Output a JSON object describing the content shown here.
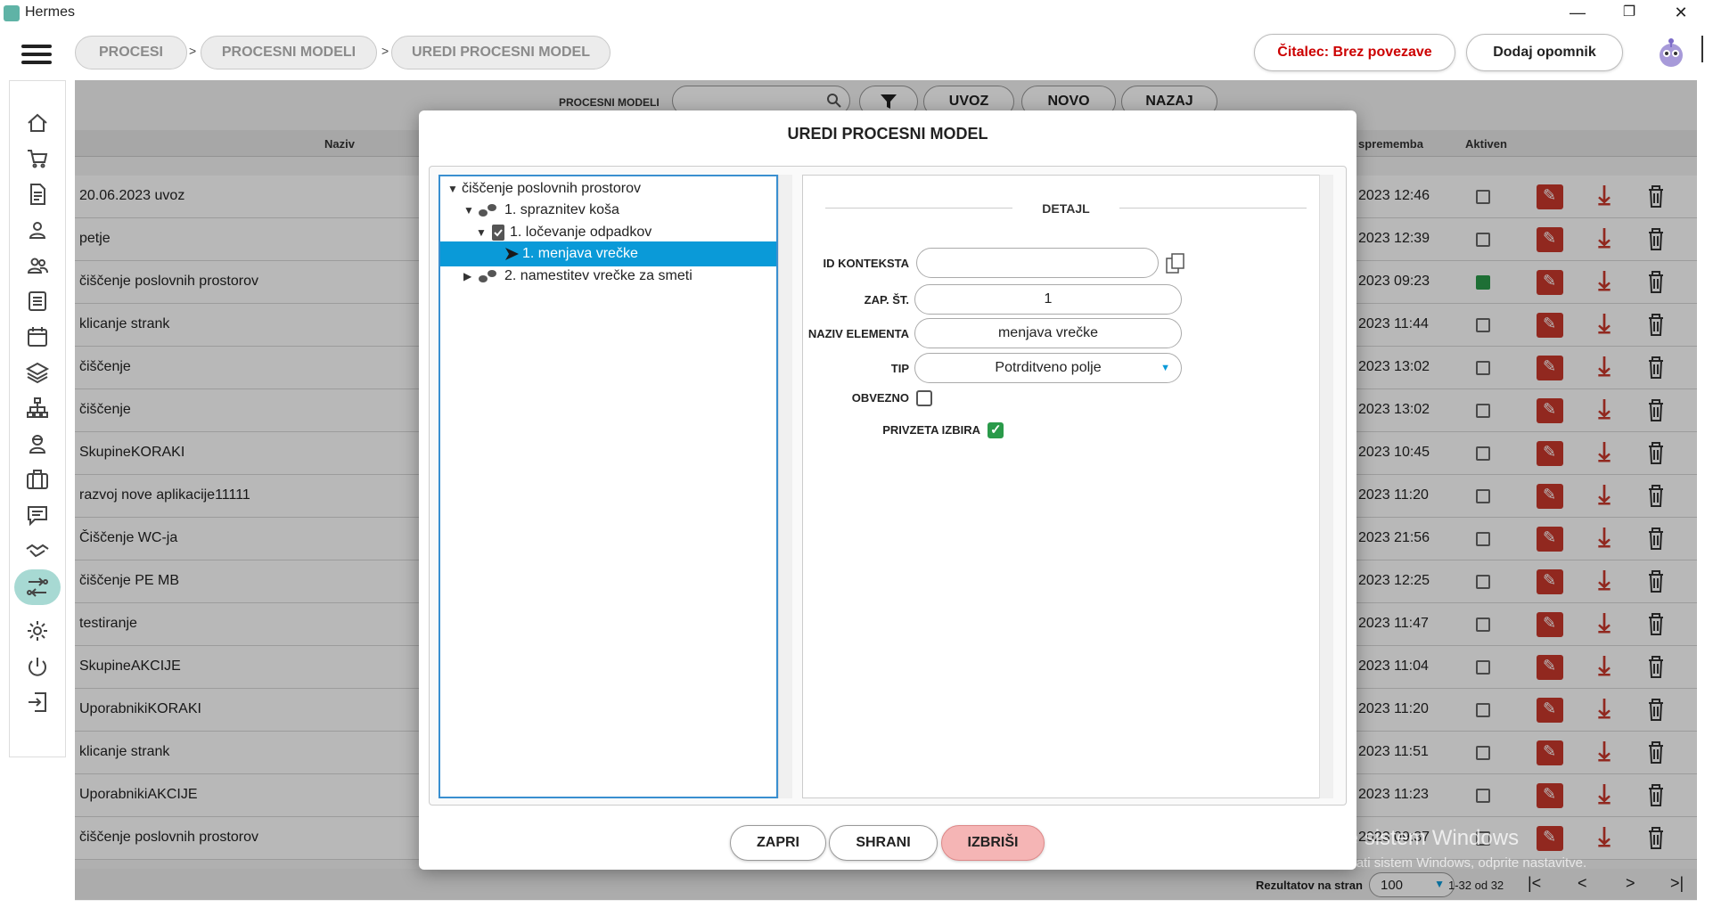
{
  "window": {
    "title": "Hermes",
    "min": "—",
    "restore": "❐",
    "close": "✕"
  },
  "breadcrumb": [
    {
      "label": "PROCESI"
    },
    {
      "label": "PROCESNI MODELI"
    },
    {
      "label": "UREDI PROCESNI MODEL"
    }
  ],
  "breadcrumb_sep": ">",
  "header": {
    "reader_status": "Čitalec: Brez povezave",
    "reader_color": "#cc0000",
    "add_reminder": "Dodaj opomnik"
  },
  "sidebar": [
    "home-icon",
    "cart-icon",
    "document-icon",
    "user-icon",
    "users-icon",
    "list-icon",
    "calendar-icon",
    "layers-icon",
    "hierarchy-icon",
    "worker-icon",
    "briefcase-icon",
    "chat-icon",
    "handshake-icon",
    "process-icon",
    "gear-icon",
    "power-icon",
    "logout-icon"
  ],
  "toolbar": {
    "label": "PROCESNI MODELI",
    "search_value": "",
    "buttons": [
      "UVOZ",
      "NOVO",
      "NAZAJ"
    ]
  },
  "list": {
    "columns": {
      "name": "Naziv",
      "changed": "sprememba",
      "active": "Aktiven"
    },
    "rows": [
      {
        "name": "20.06.2023 uvoz",
        "date": "2023 12:46",
        "active": false
      },
      {
        "name": "petje",
        "date": "2023 12:39",
        "active": false
      },
      {
        "name": "čiščenje poslovnih prostorov",
        "date": "2023 09:23",
        "active": true
      },
      {
        "name": "klicanje strank",
        "date": "2023 11:44",
        "active": false
      },
      {
        "name": "čiščenje",
        "date": "2023 13:02",
        "active": false
      },
      {
        "name": "čiščenje",
        "date": "2023 13:02",
        "active": false
      },
      {
        "name": "SkupineKORAKI",
        "date": "2023 10:45",
        "active": false
      },
      {
        "name": "razvoj nove aplikacije11111",
        "date": "2023 11:20",
        "active": false
      },
      {
        "name": "Čiščenje WC-ja",
        "date": "2023 21:56",
        "active": false
      },
      {
        "name": "čiščenje PE MB",
        "date": "2023 12:25",
        "active": false
      },
      {
        "name": "testiranje",
        "date": "2023 11:47",
        "active": false
      },
      {
        "name": "SkupineAKCIJE",
        "date": "2023 11:04",
        "active": false
      },
      {
        "name": "UporabnikiKORAKI",
        "date": "2023 11:20",
        "active": false
      },
      {
        "name": "klicanje strank",
        "date": "2023 11:51",
        "active": false
      },
      {
        "name": "UporabnikiAKCIJE",
        "date": "2023 11:23",
        "active": false
      },
      {
        "name": "čiščenje poslovnih prostorov",
        "date": "2023 09:37",
        "active": false
      }
    ]
  },
  "footer": {
    "per_page_label": "Rezultatov na stran",
    "per_page": "100",
    "range": "1-32 od 32"
  },
  "watermark": {
    "line1": "Aktivirajte sistem Windows",
    "line2": "Če želite aktivirati sistem Windows, odprite nastavitve."
  },
  "modal": {
    "title": "UREDI PROCESNI MODEL",
    "tree": [
      {
        "label": "čiščenje poslovnih prostorov",
        "expanded": true,
        "icon": ""
      },
      {
        "label": "1. spraznitev koša",
        "expanded": true,
        "icon": "steps-icon"
      },
      {
        "label": "1. ločevanje odpadkov",
        "expanded": true,
        "icon": "checklist-icon"
      },
      {
        "label": "1. menjava vrečke",
        "selected": true,
        "icon": "action-arrow-icon"
      },
      {
        "label": "2. namestitev vrečke za smeti",
        "expanded": false,
        "icon": "steps-icon"
      }
    ],
    "detail": {
      "header": "DETAJL",
      "id_context_label": "ID KONTEKSTA",
      "id_context_value": "",
      "order_label": "ZAP. ŠT.",
      "order_value": "1",
      "name_label": "NAZIV ELEMENTA",
      "name_value": "menjava vrečke",
      "type_label": "TIP",
      "type_value": "Potrditveno polje",
      "required_label": "OBVEZNO",
      "required": false,
      "default_label": "PRIVZETA IZBIRA",
      "default_checked": true
    },
    "buttons": {
      "close": "ZAPRI",
      "save": "SHRANI",
      "delete": "IZBRIŠI"
    }
  }
}
